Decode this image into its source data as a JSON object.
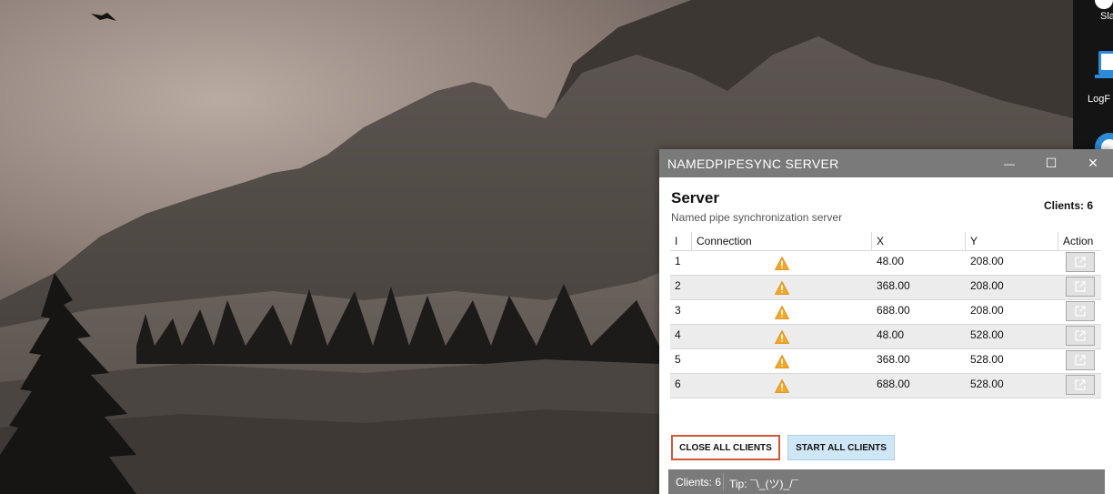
{
  "desktop": {
    "icons": [
      {
        "label": "Sla",
        "icon": "slack-icon"
      },
      {
        "label": "LogF",
        "icon": "laptop-icon"
      },
      {
        "label": "",
        "icon": "app-icon"
      }
    ]
  },
  "window": {
    "title": "NAMEDPIPESYNC SERVER",
    "controls": {
      "minimize": "—",
      "maximize": "☐",
      "close": "✕"
    }
  },
  "header": {
    "title": "Server",
    "subtitle": "Named pipe synchronization server",
    "clients": "Clients: 6"
  },
  "table": {
    "columns": [
      "I",
      "Connection",
      "X",
      "Y",
      "Action"
    ],
    "rows": [
      {
        "i": "1",
        "connection": "warning-icon",
        "x": "48.00",
        "y": "208.00"
      },
      {
        "i": "2",
        "connection": "warning-icon",
        "x": "368.00",
        "y": "208.00"
      },
      {
        "i": "3",
        "connection": "warning-icon",
        "x": "688.00",
        "y": "208.00"
      },
      {
        "i": "4",
        "connection": "warning-icon",
        "x": "48.00",
        "y": "528.00"
      },
      {
        "i": "5",
        "connection": "warning-icon",
        "x": "368.00",
        "y": "528.00"
      },
      {
        "i": "6",
        "connection": "warning-icon",
        "x": "688.00",
        "y": "528.00"
      }
    ]
  },
  "buttons": {
    "close_all": "CLOSE ALL CLIENTS",
    "start_all": "START ALL CLIENTS"
  },
  "status": {
    "clients": "Clients: 6",
    "tip": "Tip: ¯\\_(ツ)_/¯"
  },
  "colors": {
    "titlebar": "#7a7a7a",
    "close_button_border": "#d0583a",
    "start_button_bg": "#cfe6f6",
    "warning": "#f5a623"
  }
}
